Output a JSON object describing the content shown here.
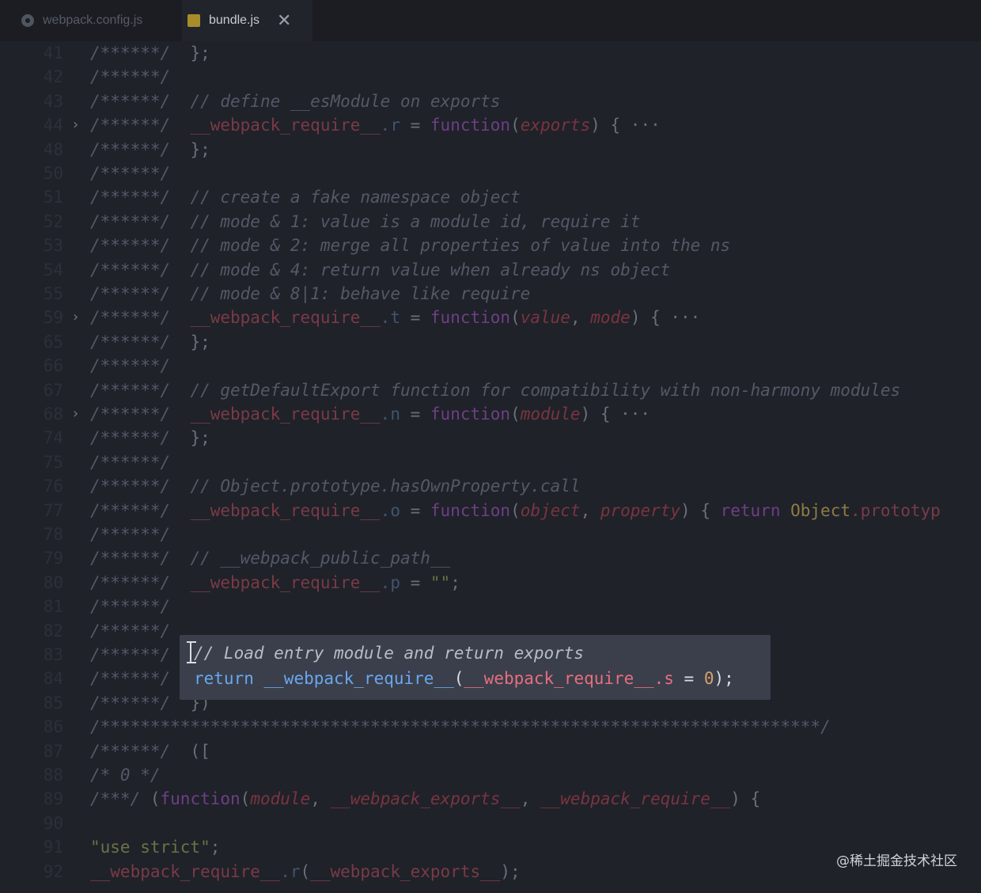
{
  "tabs": [
    {
      "label": "webpack.config.js",
      "active": false,
      "icon": "gear-icon"
    },
    {
      "label": "bundle.js",
      "active": true,
      "icon": "js-file-icon",
      "close": "✕"
    }
  ],
  "lines": [
    {
      "num": "41",
      "prefix": "/******/",
      "segments": [
        [
          "pn",
          "};"
        ]
      ]
    },
    {
      "num": "42",
      "prefix": "/******/",
      "segments": []
    },
    {
      "num": "43",
      "prefix": "/******/",
      "segments": [
        [
          "cm",
          "// define __esModule on exports"
        ]
      ]
    },
    {
      "num": "44",
      "fold": "›",
      "prefix": "/******/",
      "segments": [
        [
          "fn",
          "__webpack_require__"
        ],
        [
          "id",
          ".r"
        ],
        [
          "pn",
          " = "
        ],
        [
          "kw",
          "function"
        ],
        [
          "pn",
          "("
        ],
        [
          "prm",
          "exports"
        ],
        [
          "pn",
          ") { ···"
        ]
      ]
    },
    {
      "num": "48",
      "prefix": "/******/",
      "segments": [
        [
          "pn",
          "};"
        ]
      ]
    },
    {
      "num": "50",
      "prefix": "/******/",
      "segments": []
    },
    {
      "num": "51",
      "prefix": "/******/",
      "segments": [
        [
          "cm",
          "// create a fake namespace object"
        ]
      ]
    },
    {
      "num": "52",
      "prefix": "/******/",
      "segments": [
        [
          "cm",
          "// mode & 1: value is a module id, require it"
        ]
      ]
    },
    {
      "num": "53",
      "prefix": "/******/",
      "segments": [
        [
          "cm",
          "// mode & 2: merge all properties of value into the ns"
        ]
      ]
    },
    {
      "num": "54",
      "prefix": "/******/",
      "segments": [
        [
          "cm",
          "// mode & 4: return value when already ns object"
        ]
      ]
    },
    {
      "num": "55",
      "prefix": "/******/",
      "segments": [
        [
          "cm",
          "// mode & 8|1: behave like require"
        ]
      ]
    },
    {
      "num": "59",
      "fold": "›",
      "prefix": "/******/",
      "segments": [
        [
          "fn",
          "__webpack_require__"
        ],
        [
          "id",
          ".t"
        ],
        [
          "pn",
          " = "
        ],
        [
          "kw",
          "function"
        ],
        [
          "pn",
          "("
        ],
        [
          "prm",
          "value"
        ],
        [
          "pn",
          ", "
        ],
        [
          "prm",
          "mode"
        ],
        [
          "pn",
          ") { ···"
        ]
      ]
    },
    {
      "num": "65",
      "prefix": "/******/",
      "segments": [
        [
          "pn",
          "};"
        ]
      ]
    },
    {
      "num": "66",
      "prefix": "/******/",
      "segments": []
    },
    {
      "num": "67",
      "prefix": "/******/",
      "segments": [
        [
          "cm",
          "// getDefaultExport function for compatibility with non-harmony modules"
        ]
      ]
    },
    {
      "num": "68",
      "fold": "›",
      "prefix": "/******/",
      "segments": [
        [
          "fn",
          "__webpack_require__"
        ],
        [
          "id",
          ".n"
        ],
        [
          "pn",
          " = "
        ],
        [
          "kw",
          "function"
        ],
        [
          "pn",
          "("
        ],
        [
          "prm",
          "module"
        ],
        [
          "pn",
          ") { ···"
        ]
      ]
    },
    {
      "num": "74",
      "prefix": "/******/",
      "segments": [
        [
          "pn",
          "};"
        ]
      ]
    },
    {
      "num": "75",
      "prefix": "/******/",
      "segments": []
    },
    {
      "num": "76",
      "prefix": "/******/",
      "segments": [
        [
          "cm",
          "// Object.prototype.hasOwnProperty.call"
        ]
      ]
    },
    {
      "num": "77",
      "prefix": "/******/",
      "segments": [
        [
          "fn",
          "__webpack_require__"
        ],
        [
          "id",
          ".o"
        ],
        [
          "pn",
          " = "
        ],
        [
          "kw",
          "function"
        ],
        [
          "pn",
          "("
        ],
        [
          "prm",
          "object"
        ],
        [
          "pn",
          ", "
        ],
        [
          "prm",
          "property"
        ],
        [
          "pn",
          ") { "
        ],
        [
          "kw",
          "return "
        ],
        [
          "ob",
          "Object"
        ],
        [
          "fn",
          ".prototyp"
        ]
      ]
    },
    {
      "num": "78",
      "prefix": "/******/",
      "segments": []
    },
    {
      "num": "79",
      "prefix": "/******/",
      "segments": [
        [
          "cm",
          "// __webpack_public_path__"
        ]
      ]
    },
    {
      "num": "80",
      "prefix": "/******/",
      "segments": [
        [
          "fn",
          "__webpack_require__"
        ],
        [
          "id",
          ".p"
        ],
        [
          "pn",
          " = "
        ],
        [
          "str",
          "\"\""
        ],
        [
          "pn",
          ";"
        ]
      ]
    },
    {
      "num": "81",
      "prefix": "/******/",
      "segments": []
    },
    {
      "num": "82",
      "prefix": "/******/",
      "segments": []
    },
    {
      "num": "83",
      "prefix": "/******/",
      "segments": []
    },
    {
      "num": "84",
      "prefix": "/******/",
      "segments": []
    },
    {
      "num": "85",
      "prefix": "/******/",
      "segments": [
        [
          "pn",
          "})"
        ]
      ]
    },
    {
      "num": "86",
      "prefix": "",
      "segments": [
        [
          "cm",
          "/************************************************************************/"
        ]
      ]
    },
    {
      "num": "87",
      "prefix": "/******/",
      "segments": [
        [
          "pn",
          "(["
        ]
      ]
    },
    {
      "num": "88",
      "prefix": "",
      "segments": [
        [
          "cm",
          "/* 0 */"
        ]
      ]
    },
    {
      "num": "89",
      "prefix": "",
      "segments": [
        [
          "cm",
          "/***/ "
        ],
        [
          "pn",
          "("
        ],
        [
          "kw",
          "function"
        ],
        [
          "pn",
          "("
        ],
        [
          "prm",
          "module"
        ],
        [
          "pn",
          ", "
        ],
        [
          "prm",
          "__webpack_exports__"
        ],
        [
          "pn",
          ", "
        ],
        [
          "prm",
          "__webpack_require__"
        ],
        [
          "pn",
          ") {"
        ]
      ]
    },
    {
      "num": "90",
      "prefix": "",
      "segments": []
    },
    {
      "num": "91",
      "prefix": "",
      "segments": [
        [
          "str",
          "\"use strict\""
        ],
        [
          "pn",
          ";"
        ]
      ]
    },
    {
      "num": "92",
      "prefix": "",
      "segments": [
        [
          "fn",
          "__webpack_require__"
        ],
        [
          "id",
          ".r"
        ],
        [
          "pn",
          "("
        ],
        [
          "fn",
          "__webpack_exports__"
        ],
        [
          "pn",
          ");"
        ]
      ]
    }
  ],
  "hover_popup": {
    "comment": "// Load entry module and return exports",
    "keyword": "return",
    "fn_call": "__webpack_require__",
    "open": "(",
    "arg": "__webpack_require__",
    "prop": ".s",
    "eq": " = ",
    "num": "0",
    "close": ");"
  },
  "watermark": "@稀土掘金技术社区",
  "colors": {
    "background": "#1f2229",
    "popup_bg": "#3a3f4b",
    "keyword": "#6aa6ee",
    "function": "#e96e7c",
    "number": "#d7a16a"
  }
}
